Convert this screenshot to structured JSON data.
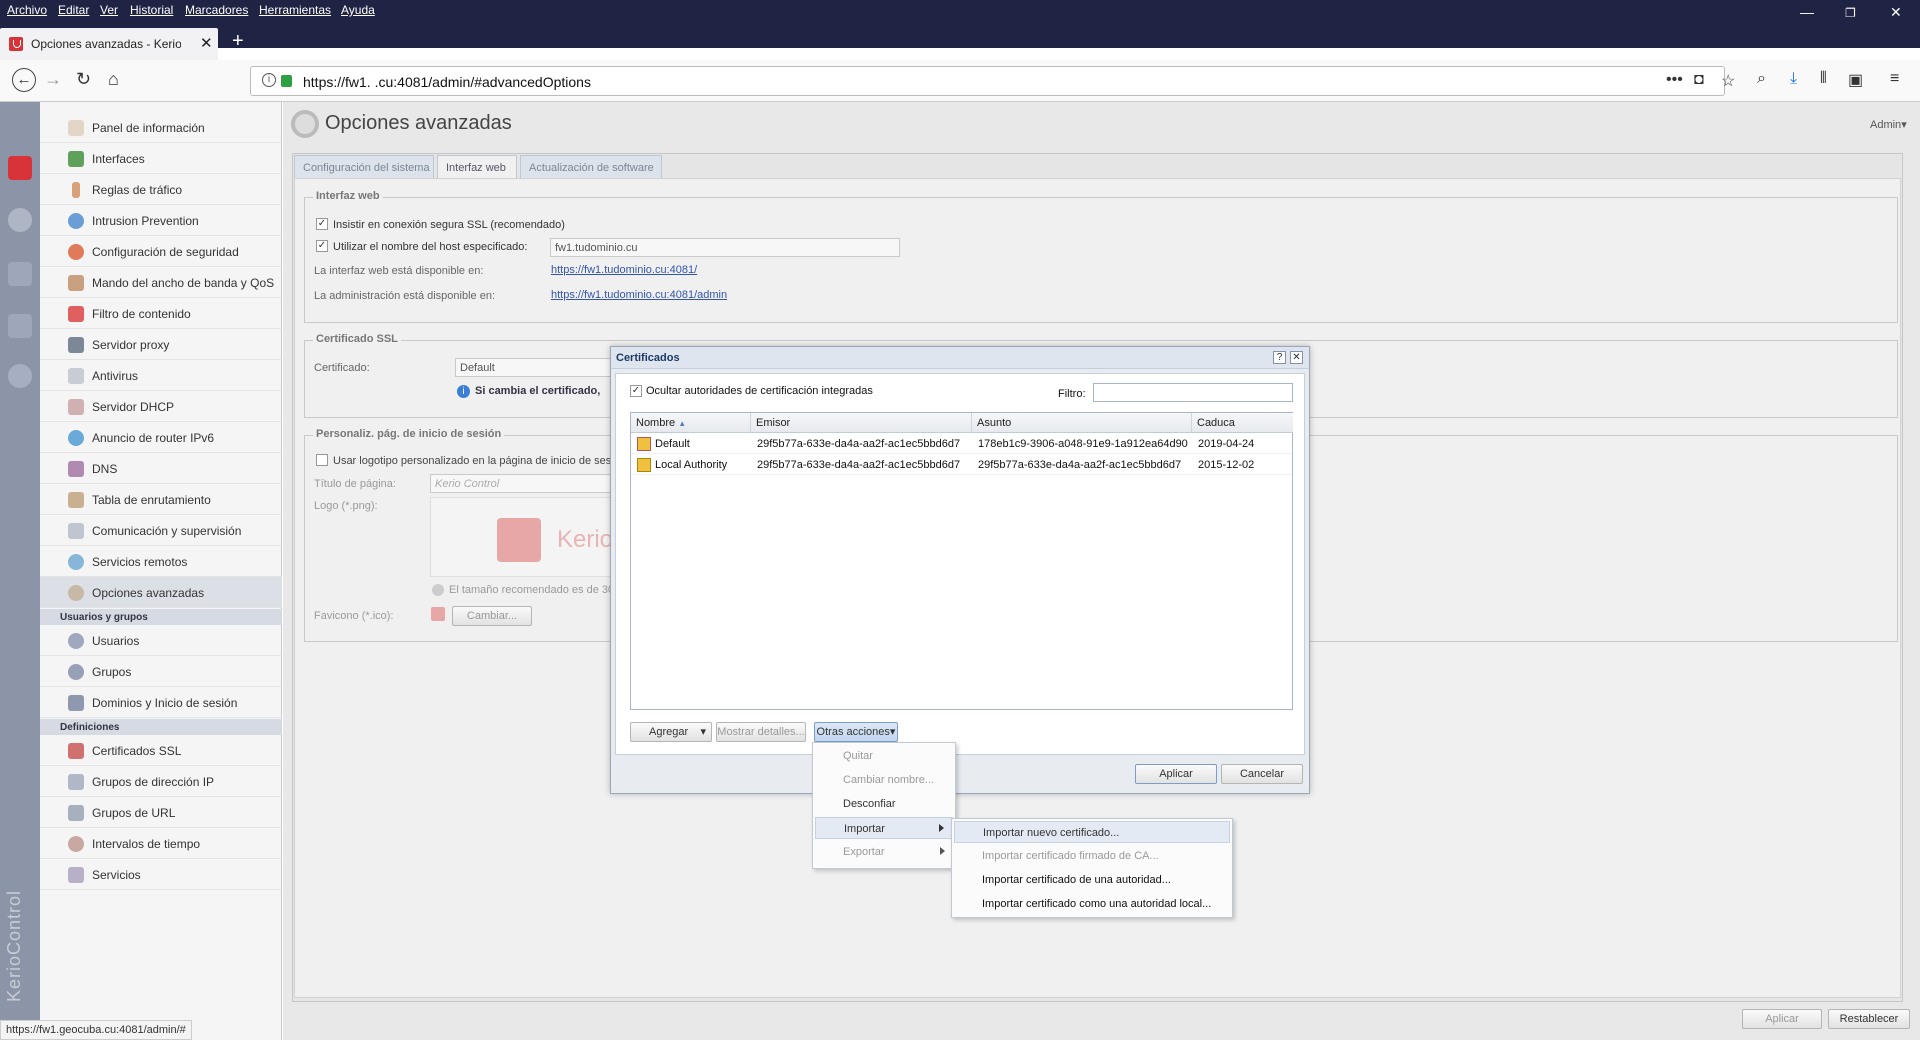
{
  "menubar": {
    "items": [
      "Archivo",
      "Editar",
      "Ver",
      "Historial",
      "Marcadores",
      "Herramientas",
      "Ayuda"
    ]
  },
  "tab": {
    "title": "Opciones avanzadas - Kerio Control"
  },
  "url": {
    "text": "https://fw1.          .cu:4081/admin/#advancedOptions"
  },
  "brand": "KerioControl",
  "sidebar": {
    "items": [
      "Panel de información",
      "Interfaces",
      "Reglas de tráfico",
      "Intrusion Prevention",
      "Configuración de seguridad",
      "Mando del ancho de banda y QoS",
      "Filtro de contenido",
      "Servidor proxy",
      "Antivirus",
      "Servidor DHCP",
      "Anuncio de router IPv6",
      "DNS",
      "Tabla de enrutamiento",
      "Comunicación y supervisión",
      "Servicios remotos",
      "Opciones avanzadas"
    ],
    "section_users": "Usuarios y grupos",
    "users": [
      "Usuarios",
      "Grupos",
      "Dominios y Inicio de sesión"
    ],
    "section_defs": "Definiciones",
    "defs": [
      "Certificados SSL",
      "Grupos de dirección IP",
      "Grupos de URL",
      "Intervalos de tiempo",
      "Servicios"
    ]
  },
  "page": {
    "title": "Opciones avanzadas",
    "user": "Admin",
    "tabs": [
      "Configuración del sistema",
      "Interfaz web",
      "Actualización de software"
    ],
    "web": {
      "legend": "Interfaz web",
      "ssl_check": "Insistir en conexión segura SSL (recomendado)",
      "host_check": "Utilizar el nombre del host especificado:",
      "host_value": "fw1.tudominio.cu",
      "web_avail": "La interfaz web está disponible en:",
      "web_link": "https://fw1.tudominio.cu:4081/",
      "admin_avail": "La administración está disponible en:",
      "admin_link": "https://fw1.tudominio.cu:4081/admin"
    },
    "ssl": {
      "legend": "Certificado SSL",
      "cert_label": "Certificado:",
      "cert_value": "Default",
      "warn": "Si cambia el certificado,"
    },
    "login": {
      "legend": "Personaliz. pág. de inicio de sesión",
      "logo_check": "Usar logotipo personalizado en la página de inicio de sesión",
      "title_label": "Título de página:",
      "title_placeholder": "Kerio Control",
      "logo_label": "Logo (*.png):",
      "logo_text": "Kerio",
      "size_note": "El tamaño recomendado es de 300",
      "favicon_label": "Favicono (*.ico):",
      "change_btn": "Cambiar..."
    },
    "apply": "Aplicar",
    "reset": "Restablecer"
  },
  "dialog": {
    "title": "Certificados",
    "help": "?",
    "hide_check": "Ocultar autoridades de certificación integradas",
    "filter_label": "Filtro:",
    "columns": [
      "Nombre",
      "Emisor",
      "Asunto",
      "Caduca"
    ],
    "rows": [
      {
        "name": "Default",
        "issuer": "29f5b77a-633e-da4a-aa2f-ac1ec5bbd6d7",
        "subject": "178eb1c9-3906-a048-91e9-1a912ea64d90",
        "expires": "2019-04-24"
      },
      {
        "name": "Local Authority",
        "issuer": "29f5b77a-633e-da4a-aa2f-ac1ec5bbd6d7",
        "subject": "29f5b77a-633e-da4a-aa2f-ac1ec5bbd6d7",
        "expires": "2015-12-02"
      }
    ],
    "add": "Agregar",
    "details": "Mostrar detalles...",
    "other": "Otras acciones",
    "apply": "Aplicar",
    "cancel": "Cancelar"
  },
  "menu": {
    "items": [
      "Quitar",
      "Cambiar nombre...",
      "Desconfiar",
      "Importar",
      "Exportar"
    ]
  },
  "submenu": {
    "items": [
      "Importar nuevo certificado...",
      "Importar certificado firmado de CA...",
      "Importar certificado de una autoridad...",
      "Importar certificado como una autoridad local..."
    ]
  },
  "status": "https://fw1.geocuba.cu:4081/admin/#",
  "colors": {
    "accent": "#d9333a",
    "titlebar": "#202444",
    "link": "#3355aa"
  }
}
